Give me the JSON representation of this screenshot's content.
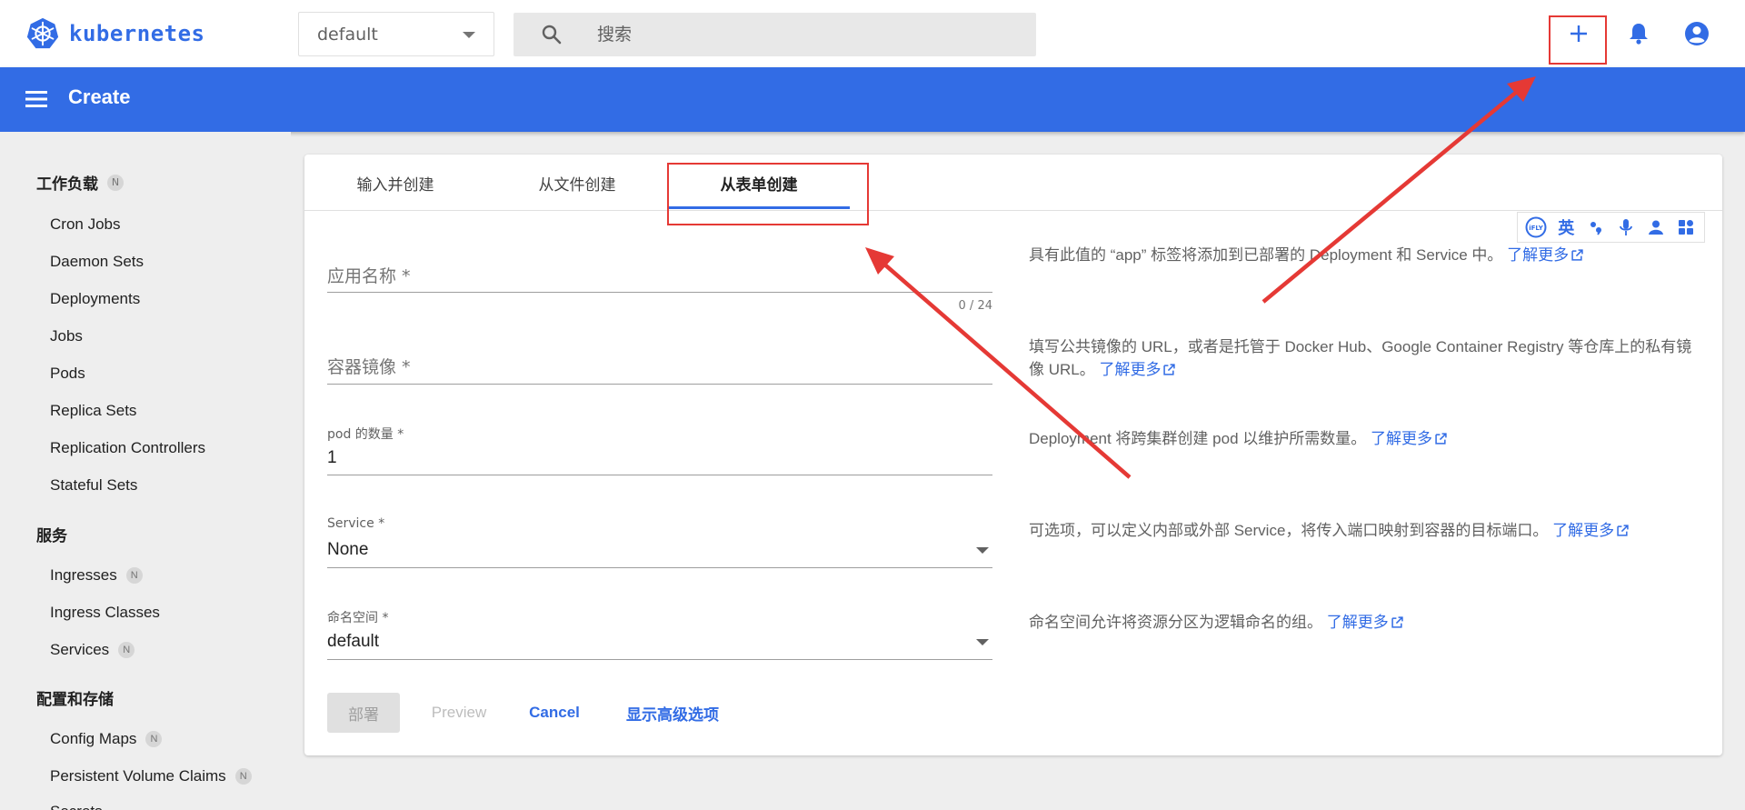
{
  "app": {
    "brand": "kubernetes",
    "brand_color": "#326ce5"
  },
  "header": {
    "namespace": "default",
    "search_placeholder": "搜索"
  },
  "toolbar": {
    "title": "Create"
  },
  "sidebar": {
    "groups": [
      {
        "label": "工作负载",
        "badge": "N"
      },
      {
        "label": "服务"
      },
      {
        "label": "配置和存储"
      }
    ],
    "workloads": [
      "Cron Jobs",
      "Daemon Sets",
      "Deployments",
      "Jobs",
      "Pods",
      "Replica Sets",
      "Replication Controllers",
      "Stateful Sets"
    ],
    "services": [
      {
        "label": "Ingresses",
        "badge": "N"
      },
      {
        "label": "Ingress Classes"
      },
      {
        "label": "Services",
        "badge": "N"
      }
    ],
    "config": [
      {
        "label": "Config Maps",
        "badge": "N"
      },
      {
        "label": "Persistent Volume Claims",
        "badge": "N"
      },
      {
        "label": "Secrets"
      }
    ]
  },
  "tabs": [
    {
      "label": "输入并创建"
    },
    {
      "label": "从文件创建"
    },
    {
      "label": "从表单创建",
      "active": true
    }
  ],
  "form": {
    "app_name": {
      "label": "应用名称 *",
      "counter": "0 / 24"
    },
    "image": {
      "label": "容器镜像 *"
    },
    "pods": {
      "label": "pod 的数量 *",
      "value": "1"
    },
    "service": {
      "label": "Service *",
      "value": "None"
    },
    "namespace": {
      "label": "命名空间 *",
      "value": "default"
    }
  },
  "help": {
    "app_name": "具有此值的 “app” 标签将添加到已部署的 Deployment 和 Service 中。",
    "image": "填写公共镜像的 URL，或者是托管于 Docker Hub、Google Container Registry 等仓库上的私有镜像 URL。",
    "pods": "Deployment 将跨集群创建 pod 以维护所需数量。",
    "service": "可选项，可以定义内部或外部 Service，将传入端口映射到容器的目标端口。",
    "namespace": "命名空间允许将资源分区为逻辑命名的组。",
    "learn_more": "了解更多"
  },
  "actions": {
    "deploy": "部署",
    "preview": "Preview",
    "cancel": "Cancel",
    "advanced": "显示高级选项"
  },
  "ifly": {
    "lang": "英"
  },
  "annotation_color": "#e53935"
}
